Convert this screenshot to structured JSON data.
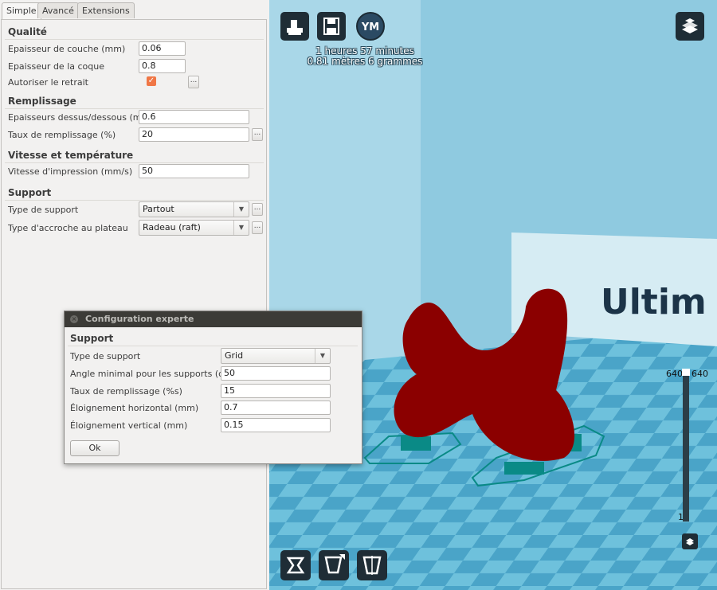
{
  "tabs": [
    {
      "label": "Simple",
      "active": true
    },
    {
      "label": "Avancé",
      "active": false
    },
    {
      "label": "Extensions",
      "active": false
    }
  ],
  "quality": {
    "title": "Qualité",
    "layer_height": {
      "label": "Epaisseur de couche (mm)",
      "value": "0.06"
    },
    "shell_thickness": {
      "label": "Epaisseur de la coque",
      "value": "0.8"
    },
    "retraction": {
      "label": "Autoriser le retrait",
      "checked": true,
      "more": "..."
    }
  },
  "fill": {
    "title": "Remplissage",
    "top_bottom": {
      "label": "Epaisseurs dessus/dessous (mm)",
      "value": "0.6"
    },
    "density": {
      "label": "Taux de remplissage (%)",
      "value": "20",
      "more": "..."
    }
  },
  "speed": {
    "title": "Vitesse et température",
    "print_speed": {
      "label": "Vitesse d'impression (mm/s)",
      "value": "50"
    }
  },
  "support": {
    "title": "Support",
    "support_type": {
      "label": "Type de support",
      "value": "Partout",
      "more": "..."
    },
    "adhesion": {
      "label": "Type d'accroche au plateau",
      "value": "Radeau (raft)",
      "more": "..."
    }
  },
  "viewport": {
    "top_buttons": [
      "load-icon",
      "save-icon",
      "youmagine-icon"
    ],
    "youmagine_label": "YM",
    "print_time": "1 heures 57 minutes",
    "material": "0.81 mètres 6 grammes",
    "view_mode_icon": "layers-view-icon",
    "bottom_buttons": [
      "rotate-icon",
      "scale-icon",
      "mirror-icon"
    ],
    "layer_slider": {
      "max": "640",
      "max_right": "640",
      "min": "1",
      "position": 1.0
    },
    "brand_text": "Ultim",
    "colors": {
      "model": "#8b0000",
      "support": "#0a8a86",
      "background": "#9fd3e6"
    }
  },
  "dialog": {
    "title": "Configuration experte",
    "close_icon": "close-icon",
    "section": "Support",
    "fields": [
      {
        "label": "Type de support",
        "value": "Grid",
        "kind": "select"
      },
      {
        "label": "Angle minimal pour les supports (deg)",
        "value": "50",
        "kind": "text"
      },
      {
        "label": "Taux de remplissage (%s)",
        "value": "15",
        "kind": "text"
      },
      {
        "label": "Éloignement horizontal (mm)",
        "value": "0.7",
        "kind": "text"
      },
      {
        "label": "Éloignement vertical (mm)",
        "value": "0.15",
        "kind": "text"
      }
    ],
    "ok_label": "Ok"
  }
}
